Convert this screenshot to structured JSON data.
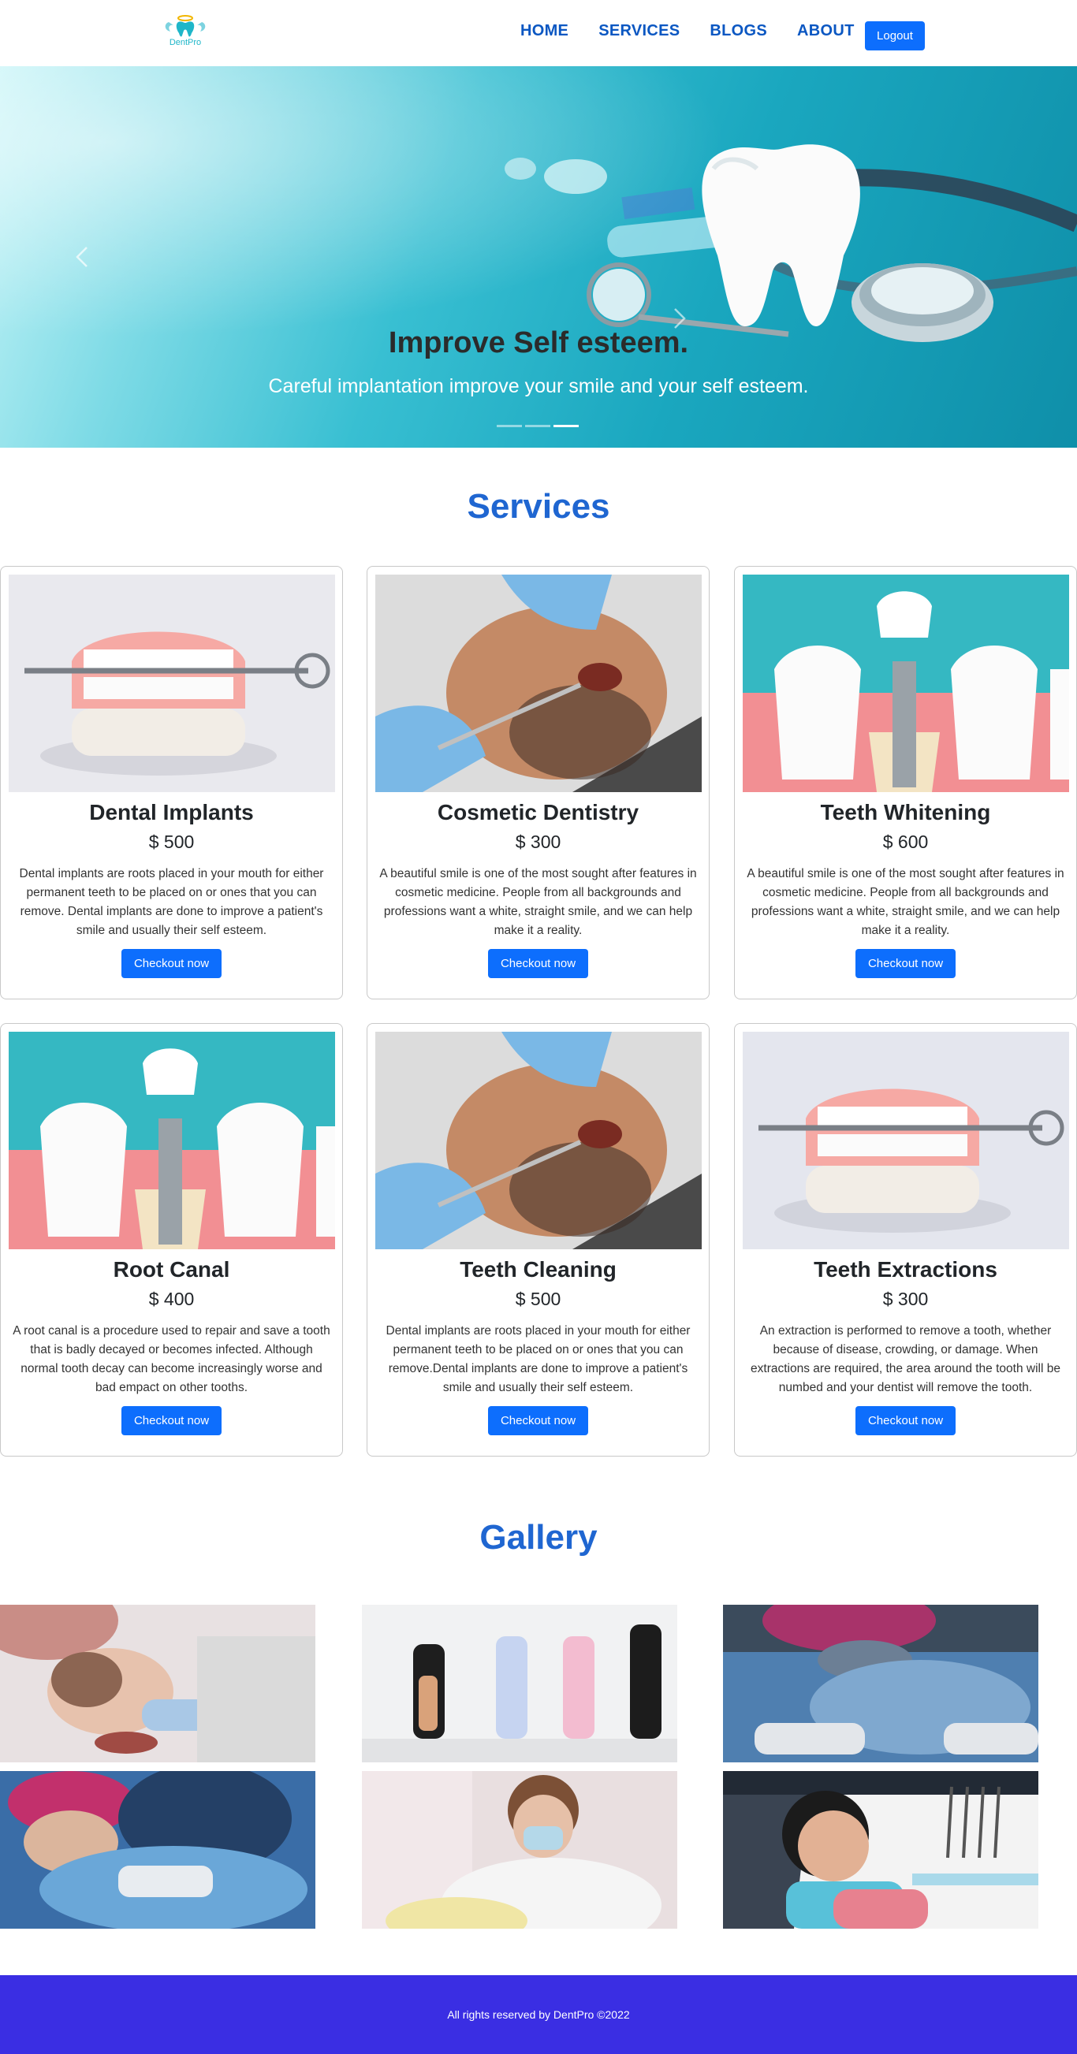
{
  "nav": {
    "logo_text": "DentPro",
    "links": [
      "HOME",
      "SERVICES",
      "BLOGS",
      "ABOUT"
    ],
    "logout_label": "Logout"
  },
  "hero": {
    "title": "Improve Self esteem.",
    "subtitle": "Careful implantation improve your smile and your self esteem.",
    "slides_count": 3,
    "active_slide": 3
  },
  "services": {
    "title": "Services",
    "cards": [
      {
        "title": "Dental Implants",
        "price": "$ 500",
        "description": "Dental implants are roots placed in your mouth for either permanent teeth to be placed on or ones that you can remove. Dental implants are done to improve a patient's smile and usually their self esteem.",
        "button": "Checkout now",
        "image": "denture-model"
      },
      {
        "title": "Cosmetic Dentistry",
        "price": "$ 300",
        "description": "A beautiful smile is one of the most sought after features in cosmetic medicine. People from all backgrounds and professions want a white, straight smile, and we can help make it a reality.",
        "button": "Checkout now",
        "image": "patient-checkup"
      },
      {
        "title": "Teeth Whitening",
        "price": "$ 600",
        "description": "A beautiful smile is one of the most sought after features in cosmetic medicine. People from all backgrounds and professions want a white, straight smile, and we can help make it a reality.",
        "button": "Checkout now",
        "image": "implant-illustration"
      },
      {
        "title": "Root Canal",
        "price": "$ 400",
        "description": "A root canal is a procedure used to repair and save a tooth that is badly decayed or becomes infected. Although normal tooth decay can become increasingly worse and bad empact on other tooths.",
        "button": "Checkout now",
        "image": "implant-illustration"
      },
      {
        "title": "Teeth Cleaning",
        "price": "$ 500",
        "description": "Dental implants are roots placed in your mouth for either permanent teeth to be placed on or ones that you can remove.Dental implants are done to improve a patient's smile and usually their self esteem.",
        "button": "Checkout now",
        "image": "patient-checkup"
      },
      {
        "title": "Teeth Extractions",
        "price": "$ 300",
        "description": "An extraction is performed to remove a tooth, whether because of disease, crowding, or damage. When extractions are required, the area around the tooth will be numbed and your dentist will remove the tooth.",
        "button": "Checkout now",
        "image": "denture-model"
      }
    ]
  },
  "gallery": {
    "title": "Gallery",
    "images": [
      "child-patient",
      "toothbrushes",
      "surgeons",
      "surgery-team",
      "dentist-working",
      "smiling-patient"
    ]
  },
  "footer": {
    "text": "All rights reserved by DentPro ©2022"
  },
  "colors": {
    "nav_link": "#0b57c2",
    "button": "#0d6efd",
    "section_title": "#1f66d1",
    "footer_bg": "#3a2ee3"
  }
}
